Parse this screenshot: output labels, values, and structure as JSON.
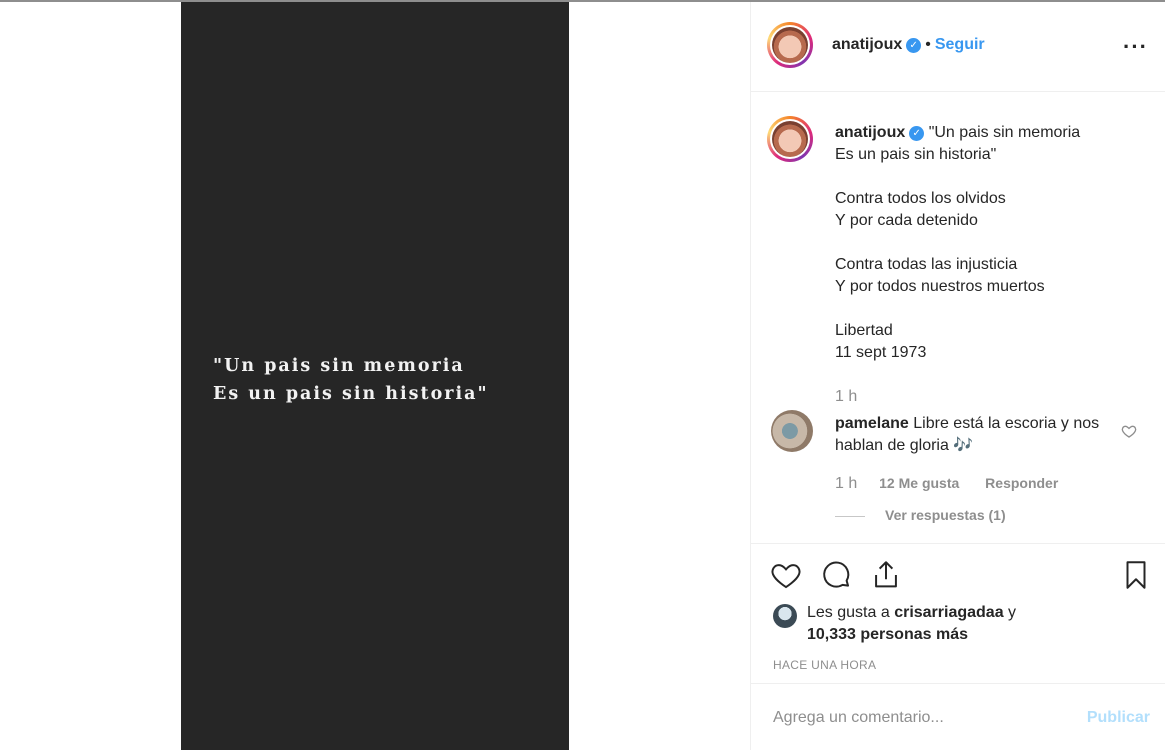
{
  "media": {
    "quote_line1": "\"Un pais sin memoria",
    "quote_line2": "Es un pais sin historia\""
  },
  "header": {
    "username": "anatijoux",
    "dot": "•",
    "follow_label": "Seguir",
    "more_label": "···"
  },
  "caption": {
    "username": "anatijoux",
    "text": "\"Un pais sin memoria\nEs un pais sin historia\"\n\nContra todos los olvidos\nY por cada detenido\n\nContra todas las injusticia\nY por todos nuestros muertos\n\nLibertad\n11 sept 1973",
    "time": "1 h"
  },
  "comment": {
    "username": "pamelane",
    "text": "Libre está la escoria y nos hablan de gloria 🎶",
    "time": "1 h",
    "likes": "12 Me gusta",
    "reply_label": "Responder",
    "view_replies": "Ver respuestas (1)"
  },
  "likes": {
    "prefix": "Les gusta a",
    "user": "crisarriagadaa",
    "conj": "y",
    "others": "10,333 personas más"
  },
  "timestamp": "HACE UNA HORA",
  "add_comment": {
    "placeholder": "Agrega un comentario...",
    "post_label": "Publicar"
  },
  "icons": {
    "verified": "verified-badge-icon",
    "like": "heart-icon",
    "comment": "comment-icon",
    "share": "share-icon",
    "save": "bookmark-icon"
  },
  "colors": {
    "accent": "#3897f0",
    "media_bg": "#262626",
    "muted": "#8e8e8e"
  }
}
